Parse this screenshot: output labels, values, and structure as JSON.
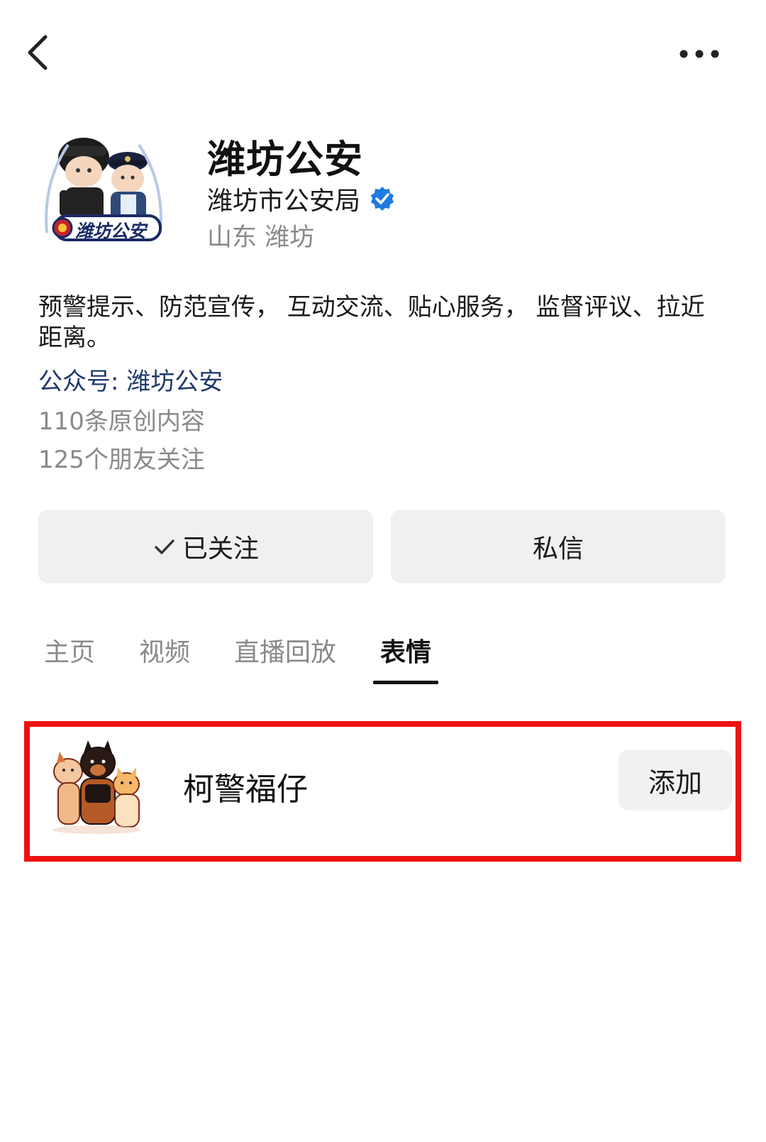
{
  "profile": {
    "name": "潍坊公安",
    "org": "潍坊市公安局",
    "location": "山东 潍坊",
    "avatar_text": "潍坊公安",
    "verified_color": "#1f7ae0"
  },
  "bio": {
    "text": "预警提示、防范宣传， 互动交流、贴心服务， 监督评议、拉近距离。",
    "official_account": "公众号: 潍坊公安",
    "original_count": "110条原创内容",
    "friends_follow": "125个朋友关注"
  },
  "actions": {
    "follow_label": "已关注",
    "message_label": "私信"
  },
  "tabs": [
    {
      "label": "主页",
      "active": false
    },
    {
      "label": "视频",
      "active": false
    },
    {
      "label": "直播回放",
      "active": false
    },
    {
      "label": "表情",
      "active": true
    }
  ],
  "sticker": {
    "name": "柯警福仔",
    "add_label": "添加"
  },
  "colors": {
    "highlight": "#ee1111",
    "link": "#1f3a6b",
    "muted": "#8a8a8a"
  }
}
